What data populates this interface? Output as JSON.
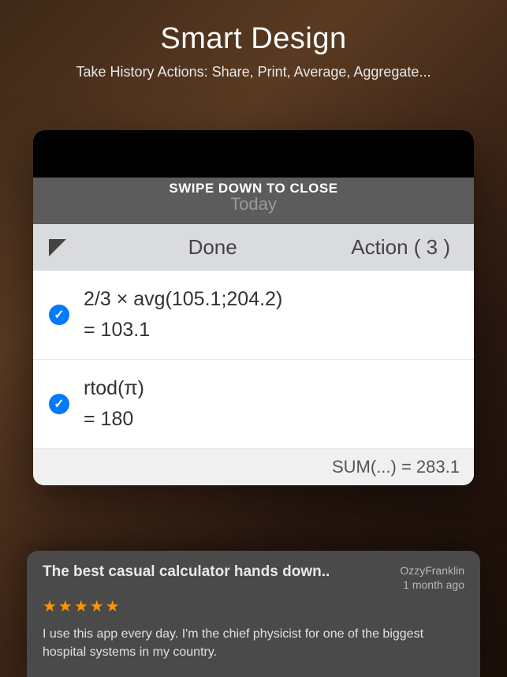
{
  "hero": {
    "title": "Smart Design",
    "subtitle": "Take History Actions: Share, Print, Average, Aggregate..."
  },
  "swipe_label": "SWIPE DOWN TO CLOSE",
  "today_label": "Today",
  "toolbar": {
    "done_label": "Done",
    "action_label": "Action ( 3 )"
  },
  "history": {
    "items": [
      {
        "expression": "2/3 × avg(105.1;204.2)",
        "result": "= 103.1"
      },
      {
        "expression": "rtod(π)",
        "result": "= 180"
      }
    ],
    "sum_label": "SUM(...) = 283.1"
  },
  "review": {
    "title": "The best casual calculator hands down..",
    "author": "OzzyFranklin",
    "time": "1 month ago",
    "stars": "★★★★★",
    "body": "I use this app every day. I'm the chief physicist for one of the biggest hospital systems in my country."
  }
}
